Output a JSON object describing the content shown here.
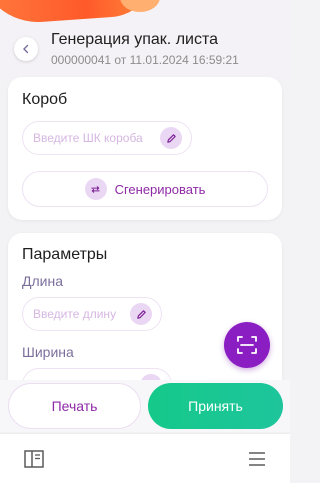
{
  "header": {
    "title": "Генерация упак. листа",
    "subtitle": "000000041 от 11.01.2024 16:59:21"
  },
  "box_card": {
    "title": "Короб",
    "barcode_placeholder": "Введите ШК короба",
    "generate_label": "Сгенерировать"
  },
  "params_card": {
    "title": "Параметры",
    "length_label": "Длина",
    "length_placeholder": "Введите длину",
    "width_label": "Ширина"
  },
  "actions": {
    "print_label": "Печать",
    "accept_label": "Принять"
  },
  "icons": {
    "back": "chevron-left-icon",
    "edit": "pencil-icon",
    "generate": "repeat-icon",
    "scan": "barcode-scan-icon",
    "nav_left": "book-icon",
    "nav_right": "menu-icon"
  },
  "colors": {
    "accent": "#8a1ec2",
    "accept": "#1ec59c",
    "brand_orange": "#ff5a2a"
  }
}
